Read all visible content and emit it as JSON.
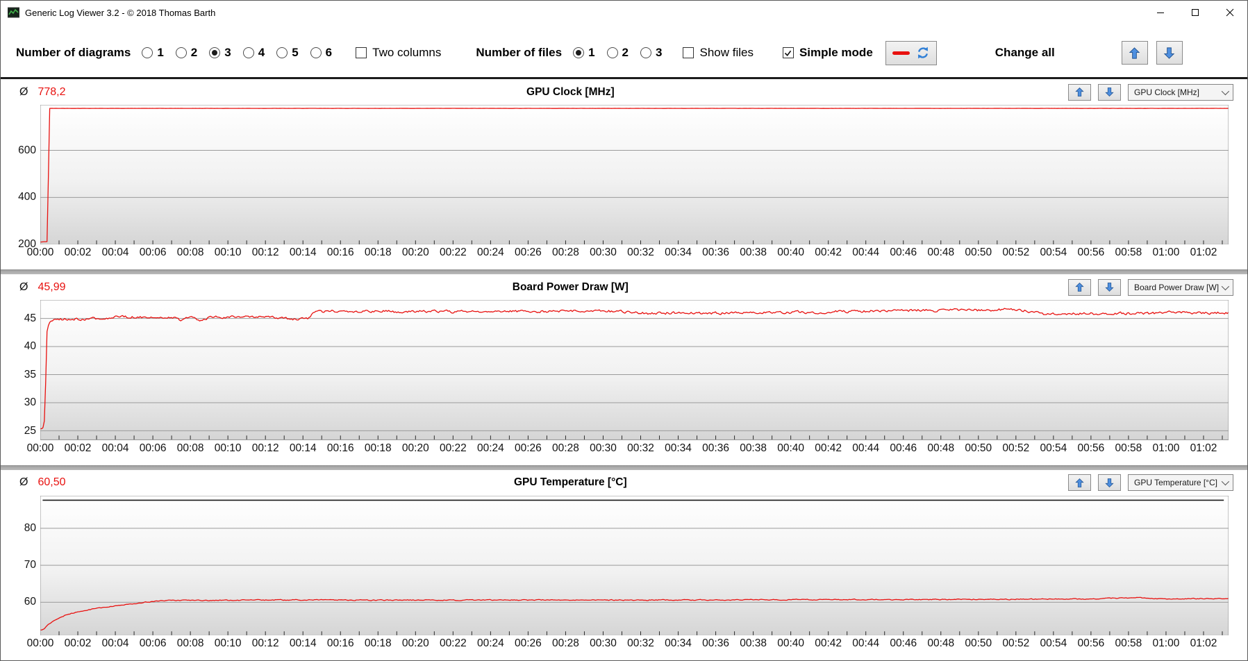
{
  "window": {
    "title": "Generic Log Viewer 3.2 - © 2018 Thomas Barth"
  },
  "toolbar": {
    "diagrams_label": "Number of diagrams",
    "diagram_options": [
      "1",
      "2",
      "3",
      "4",
      "5",
      "6"
    ],
    "diagrams_selected": "3",
    "two_columns_label": "Two columns",
    "two_columns_checked": false,
    "files_label": "Number of files",
    "file_options": [
      "1",
      "2",
      "3"
    ],
    "files_selected": "1",
    "show_files_label": "Show files",
    "show_files_checked": false,
    "simple_mode_label": "Simple mode",
    "simple_mode_checked": true,
    "change_all_label": "Change all"
  },
  "colors": {
    "accent_red": "#e8110f",
    "arrow_blue": "#3d7edb",
    "grid": "#9b9b9b",
    "plot_border": "#8f8f8f",
    "plot_gradient_top": "#ffffff",
    "plot_gradient_bottom": "#d5d5d5",
    "max_line": "#1a1a1a"
  },
  "chart_data": [
    {
      "type": "line",
      "title": "GPU Clock [MHz]",
      "average_label": "Ø",
      "average_value": "778,2",
      "dropdown_value": "GPU Clock [MHz]",
      "line_color": "#e8110f",
      "y_ticks": [
        200,
        400,
        600
      ],
      "y_range": [
        200,
        793
      ],
      "x_range_seconds": [
        0,
        3800
      ],
      "x_tick_interval_seconds": 120,
      "x_ticks": [
        "00:00",
        "00:02",
        "00:04",
        "00:06",
        "00:08",
        "00:10",
        "00:12",
        "00:14",
        "00:16",
        "00:18",
        "00:20",
        "00:22",
        "00:24",
        "00:26",
        "00:28",
        "00:30",
        "00:32",
        "00:34",
        "00:36",
        "00:38",
        "00:40",
        "00:42",
        "00:44",
        "00:46",
        "00:48",
        "00:50",
        "00:52",
        "00:54",
        "00:56",
        "00:58",
        "01:00",
        "01:02"
      ],
      "noise": 0.25,
      "keyframes": [
        [
          0,
          211
        ],
        [
          22,
          213
        ],
        [
          30,
          778
        ],
        [
          3800,
          778
        ]
      ]
    },
    {
      "type": "line",
      "title": "Board Power Draw [W]",
      "average_label": "Ø",
      "average_value": "45,99",
      "dropdown_value": "Board Power Draw [W]",
      "line_color": "#e8110f",
      "y_ticks": [
        25,
        30,
        35,
        40,
        45
      ],
      "y_range": [
        23.4,
        48.3
      ],
      "x_range_seconds": [
        0,
        3800
      ],
      "x_tick_interval_seconds": 120,
      "x_ticks": [
        "00:00",
        "00:02",
        "00:04",
        "00:06",
        "00:08",
        "00:10",
        "00:12",
        "00:14",
        "00:16",
        "00:18",
        "00:20",
        "00:22",
        "00:24",
        "00:26",
        "00:28",
        "00:30",
        "00:32",
        "00:34",
        "00:36",
        "00:38",
        "00:40",
        "00:42",
        "00:44",
        "00:46",
        "00:48",
        "00:50",
        "00:52",
        "00:54",
        "00:56",
        "00:58",
        "01:00",
        "01:02"
      ],
      "noise": 0.22,
      "keyframes": [
        [
          0,
          25.2
        ],
        [
          8,
          25.4
        ],
        [
          14,
          27
        ],
        [
          22,
          43.5
        ],
        [
          35,
          44.6
        ],
        [
          60,
          44.8
        ],
        [
          120,
          44.9
        ],
        [
          180,
          45.0
        ],
        [
          240,
          45.2
        ],
        [
          300,
          45.3
        ],
        [
          360,
          45.2
        ],
        [
          420,
          45.15
        ],
        [
          450,
          44.8
        ],
        [
          480,
          45.2
        ],
        [
          510,
          44.7
        ],
        [
          540,
          45.2
        ],
        [
          600,
          45.25
        ],
        [
          660,
          45.3
        ],
        [
          720,
          45.2
        ],
        [
          780,
          45.1
        ],
        [
          810,
          44.8
        ],
        [
          840,
          45.0
        ],
        [
          858,
          45.1
        ],
        [
          872,
          46.1
        ],
        [
          900,
          46.2
        ],
        [
          960,
          46.35
        ],
        [
          1020,
          46.2
        ],
        [
          1080,
          46.3
        ],
        [
          1140,
          46.25
        ],
        [
          1200,
          46.2
        ],
        [
          1260,
          46.3
        ],
        [
          1320,
          46.2
        ],
        [
          1380,
          46.25
        ],
        [
          1440,
          46.2
        ],
        [
          1500,
          46.3
        ],
        [
          1560,
          46.25
        ],
        [
          1620,
          46.3
        ],
        [
          1680,
          46.35
        ],
        [
          1740,
          46.3
        ],
        [
          1800,
          46.35
        ],
        [
          1860,
          46.2
        ],
        [
          1900,
          45.95
        ],
        [
          1960,
          45.9
        ],
        [
          2020,
          46.0
        ],
        [
          2080,
          45.9
        ],
        [
          2140,
          45.95
        ],
        [
          2200,
          46.0
        ],
        [
          2260,
          45.95
        ],
        [
          2320,
          46.0
        ],
        [
          2380,
          46.05
        ],
        [
          2440,
          46.1
        ],
        [
          2500,
          46.15
        ],
        [
          2560,
          46.2
        ],
        [
          2620,
          46.3
        ],
        [
          2680,
          46.35
        ],
        [
          2740,
          46.4
        ],
        [
          2800,
          46.45
        ],
        [
          2860,
          46.4
        ],
        [
          2920,
          46.5
        ],
        [
          2960,
          46.55
        ],
        [
          3000,
          46.45
        ],
        [
          3040,
          46.5
        ],
        [
          3080,
          46.6
        ],
        [
          3120,
          46.45
        ],
        [
          3160,
          46.3
        ],
        [
          3190,
          46.2
        ],
        [
          3210,
          45.75
        ],
        [
          3260,
          45.8
        ],
        [
          3310,
          45.9
        ],
        [
          3360,
          45.85
        ],
        [
          3410,
          45.9
        ],
        [
          3460,
          45.95
        ],
        [
          3510,
          45.85
        ],
        [
          3560,
          45.9
        ],
        [
          3610,
          46.05
        ],
        [
          3660,
          46.1
        ],
        [
          3700,
          45.95
        ],
        [
          3750,
          46.0
        ],
        [
          3800,
          46.0
        ]
      ]
    },
    {
      "type": "line",
      "title": "GPU Temperature [°C]",
      "average_label": "Ø",
      "average_value": "60,50",
      "dropdown_value": "GPU Temperature [°C]",
      "line_color": "#e8110f",
      "y_ticks": [
        60,
        70,
        80
      ],
      "y_range": [
        51,
        88.8
      ],
      "x_range_seconds": [
        0,
        3800
      ],
      "x_tick_interval_seconds": 120,
      "x_ticks": [
        "00:00",
        "00:02",
        "00:04",
        "00:06",
        "00:08",
        "00:10",
        "00:12",
        "00:14",
        "00:16",
        "00:18",
        "00:20",
        "00:22",
        "00:24",
        "00:26",
        "00:28",
        "00:30",
        "00:32",
        "00:34",
        "00:36",
        "00:38",
        "00:40",
        "00:42",
        "00:44",
        "00:46",
        "00:48",
        "00:50",
        "00:52",
        "00:54",
        "00:56",
        "00:58",
        "01:00",
        "01:02"
      ],
      "noise": 0.12,
      "max_line": 87.6,
      "keyframes": [
        [
          0,
          52.4
        ],
        [
          10,
          52.6
        ],
        [
          30,
          54.2
        ],
        [
          60,
          55.8
        ],
        [
          90,
          56.8
        ],
        [
          120,
          57.4
        ],
        [
          150,
          57.9
        ],
        [
          180,
          58.3
        ],
        [
          210,
          58.7
        ],
        [
          240,
          59.0
        ],
        [
          270,
          59.3
        ],
        [
          300,
          59.6
        ],
        [
          330,
          59.9
        ],
        [
          360,
          60.2
        ],
        [
          390,
          60.4
        ],
        [
          420,
          60.5
        ],
        [
          480,
          60.55
        ],
        [
          540,
          60.5
        ],
        [
          600,
          60.55
        ],
        [
          720,
          60.6
        ],
        [
          840,
          60.65
        ],
        [
          960,
          60.6
        ],
        [
          1080,
          60.55
        ],
        [
          1200,
          60.6
        ],
        [
          1320,
          60.55
        ],
        [
          1440,
          60.6
        ],
        [
          1560,
          60.6
        ],
        [
          1680,
          60.65
        ],
        [
          1800,
          60.6
        ],
        [
          1920,
          60.6
        ],
        [
          2040,
          60.65
        ],
        [
          2160,
          60.6
        ],
        [
          2280,
          60.65
        ],
        [
          2400,
          60.7
        ],
        [
          2520,
          60.7
        ],
        [
          2640,
          60.75
        ],
        [
          2760,
          60.7
        ],
        [
          2880,
          60.75
        ],
        [
          3000,
          60.8
        ],
        [
          3120,
          60.8
        ],
        [
          3240,
          60.85
        ],
        [
          3360,
          60.9
        ],
        [
          3440,
          61.1
        ],
        [
          3500,
          61.25
        ],
        [
          3560,
          61.0
        ],
        [
          3620,
          60.95
        ],
        [
          3680,
          61.0
        ],
        [
          3740,
          61.0
        ],
        [
          3800,
          61.0
        ]
      ]
    }
  ]
}
